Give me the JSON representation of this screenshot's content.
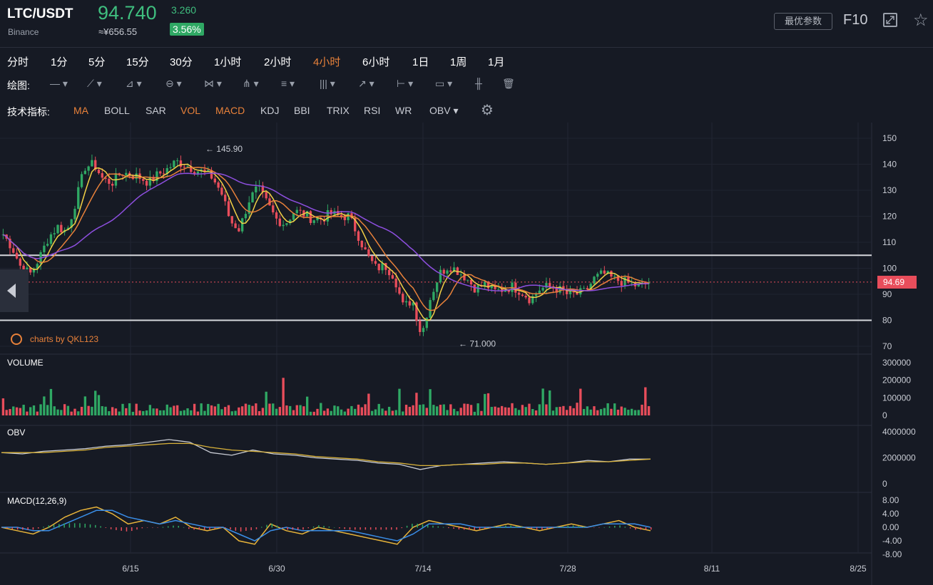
{
  "header": {
    "pair": "LTC/USDT",
    "exchange": "Binance",
    "price": "94.740",
    "price_cny": "≈¥656.55",
    "change": "3.260",
    "change_pct": "3.56%",
    "params_button": "最优参数",
    "f10_button": "F10"
  },
  "timeframes": {
    "items": [
      "分时",
      "1分",
      "5分",
      "15分",
      "30分",
      "1小时",
      "2小时",
      "4小时",
      "6小时",
      "1日",
      "1周",
      "1月"
    ],
    "active": "4小时"
  },
  "drawing": {
    "label": "绘图:"
  },
  "indicators": {
    "label": "技术指标:",
    "items": [
      "MA",
      "BOLL",
      "SAR",
      "VOL",
      "MACD",
      "KDJ",
      "BBI",
      "TRIX",
      "RSI",
      "WR",
      "OBV"
    ],
    "active": [
      "MA",
      "VOL",
      "MACD"
    ]
  },
  "brand": "charts by QKL123",
  "chart_data": [
    {
      "type": "candlestick",
      "x": [
        "6/15",
        "6/30",
        "7/14",
        "7/28",
        "8/11",
        "8/25"
      ],
      "y_ticks": [
        150,
        140,
        130,
        120,
        110,
        100,
        90,
        80,
        70
      ],
      "ylim": [
        68,
        152
      ],
      "annotations": [
        {
          "label": "145.90",
          "value": 145.9
        },
        {
          "label": "71.000",
          "value": 71.0
        }
      ],
      "horizontal_lines": [
        105,
        80
      ],
      "last_price": {
        "label": "94.69",
        "value": 94.69
      },
      "price_path": [
        113,
        108,
        100,
        98,
        104,
        112,
        116,
        114,
        126,
        139,
        140,
        134,
        133,
        137,
        136,
        135,
        133,
        136,
        138,
        141,
        140,
        138,
        137,
        135,
        129,
        118,
        115,
        126,
        131,
        125,
        119,
        117,
        122,
        121,
        119,
        119,
        121,
        120,
        120,
        113,
        105,
        100,
        101,
        97,
        85,
        88,
        74,
        89,
        98,
        101,
        99,
        96,
        92,
        94,
        91,
        92,
        93,
        91,
        88,
        92,
        93,
        92,
        90,
        90,
        91,
        96,
        98,
        96,
        95,
        94,
        93,
        94.7
      ],
      "colors": {
        "up": "#2fa864",
        "down": "#e84d5b",
        "ma_fast": "#f2d046",
        "ma_mid": "#e8813a",
        "ma_slow": "#8e4fe0"
      }
    },
    {
      "type": "bar",
      "title": "VOLUME",
      "y_ticks": [
        300000,
        200000,
        100000,
        0
      ],
      "ylim": [
        0,
        300000
      ]
    },
    {
      "type": "line",
      "title": "OBV",
      "y_ticks": [
        4000000,
        2000000,
        0
      ],
      "ylim": [
        0,
        4000000
      ],
      "series": [
        {
          "values": [
            2.4,
            2.3,
            2.5,
            2.6,
            2.7,
            2.9,
            3.0,
            3.2,
            3.4,
            3.2,
            2.4,
            2.2,
            2.6,
            2.3,
            2.2,
            2.0,
            1.9,
            1.8,
            1.6,
            1.5,
            1.1,
            1.4,
            1.5,
            1.6,
            1.7,
            1.6,
            1.5,
            1.6,
            1.8,
            1.7,
            1.9,
            1.9
          ]
        },
        {
          "values": [
            2.4,
            2.4,
            2.4,
            2.5,
            2.6,
            2.8,
            2.9,
            3.0,
            3.1,
            3.1,
            2.8,
            2.6,
            2.5,
            2.4,
            2.3,
            2.1,
            2.0,
            1.9,
            1.7,
            1.6,
            1.4,
            1.4,
            1.5,
            1.5,
            1.6,
            1.6,
            1.5,
            1.6,
            1.7,
            1.7,
            1.8,
            1.9
          ]
        }
      ]
    },
    {
      "type": "line",
      "title": "MACD(12,26,9)",
      "y_ticks": [
        "8.00",
        "4.00",
        "0.00",
        "-4.00",
        "-8.00"
      ],
      "ylim": [
        -8,
        8
      ],
      "series": [
        {
          "values": [
            0,
            -1,
            -2,
            0,
            3,
            5,
            6,
            4,
            1,
            2,
            1,
            3,
            0,
            -1,
            0,
            -4,
            -5,
            1,
            -1,
            -2,
            0,
            -1,
            -2,
            -3,
            -4,
            -5,
            0,
            2,
            1,
            0,
            -1,
            0,
            1,
            0,
            -1,
            0,
            1,
            0,
            1,
            2,
            0,
            -1
          ]
        },
        {
          "values": [
            0,
            0,
            -1,
            -1,
            1,
            3,
            5,
            5,
            3,
            2,
            1,
            2,
            1,
            0,
            0,
            -2,
            -4,
            -1,
            0,
            -1,
            -1,
            -1,
            -1,
            -2,
            -3,
            -4,
            -2,
            1,
            1,
            1,
            0,
            0,
            0,
            0,
            0,
            0,
            0,
            0,
            1,
            1,
            1,
            0
          ]
        }
      ]
    }
  ]
}
